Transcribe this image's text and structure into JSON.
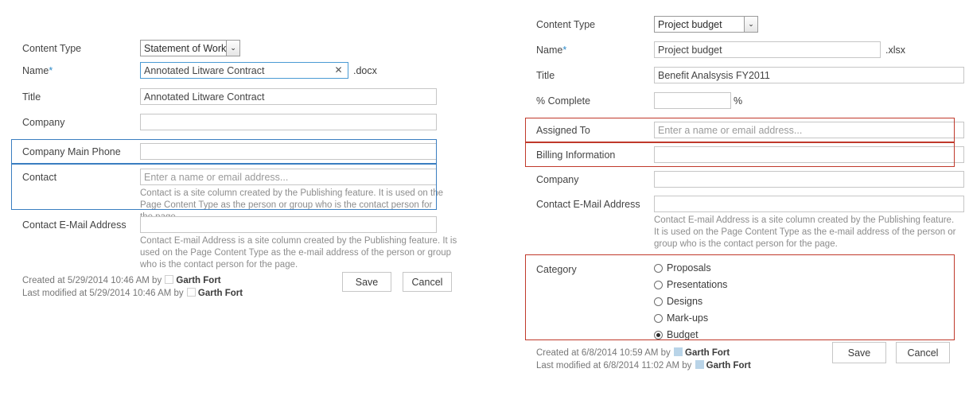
{
  "left_form": {
    "content_type": {
      "label": "Content Type",
      "value": "Statement of Work",
      "arrow": "⌄"
    },
    "name": {
      "label": "Name",
      "required_mark": "*",
      "value": "Annotated Litware Contract",
      "extension": ".docx",
      "clear_glyph": "✕"
    },
    "title": {
      "label": "Title",
      "value": "Annotated Litware Contract"
    },
    "company": {
      "label": "Company",
      "value": ""
    },
    "company_main_phone": {
      "label": "Company Main Phone",
      "value": ""
    },
    "contact": {
      "label": "Contact",
      "placeholder": "Enter a name or email address...",
      "hint": "Contact is a site column created by the Publishing feature. It is used on the Page Content Type as the person or group who is the contact person for the page."
    },
    "contact_email": {
      "label": "Contact E-Mail Address",
      "value": "",
      "hint": "Contact E-mail Address is a site column created by the Publishing feature. It is used on the Page Content Type as the e-mail address of the person or group who is the contact person for the page."
    },
    "footer": {
      "created": "Created at 5/29/2014 10:46 AM",
      "created_by_prefix": "by",
      "created_by": "Garth Fort",
      "modified": "Last modified at 5/29/2014 10:46 AM",
      "modified_by_prefix": "by",
      "modified_by": "Garth Fort",
      "save_label": "Save",
      "cancel_label": "Cancel"
    },
    "highlight_color": "#3a7ec1"
  },
  "right_form": {
    "content_type": {
      "label": "Content Type",
      "value": "Project budget",
      "arrow": "⌄"
    },
    "name": {
      "label": "Name",
      "required_mark": "*",
      "value": "Project budget",
      "extension": ".xlsx"
    },
    "title": {
      "label": "Title",
      "value": "Benefit Analsysis FY2011"
    },
    "percent_complete": {
      "label": "% Complete",
      "value": "",
      "suffix": "%"
    },
    "assigned_to": {
      "label": "Assigned To",
      "placeholder": "Enter a name or email address..."
    },
    "billing_information": {
      "label": "Billing Information",
      "value": ""
    },
    "company": {
      "label": "Company",
      "value": ""
    },
    "contact_email": {
      "label": "Contact E-Mail Address",
      "value": "",
      "hint": "Contact E-mail Address is a site column created by the Publishing feature. It is used on the Page Content Type as the e-mail address of the person or group who is the contact person for the page."
    },
    "category": {
      "label": "Category",
      "options": [
        {
          "label": "Proposals",
          "checked": false
        },
        {
          "label": "Presentations",
          "checked": false
        },
        {
          "label": "Designs",
          "checked": false
        },
        {
          "label": "Mark-ups",
          "checked": false
        },
        {
          "label": "Budget",
          "checked": true
        }
      ]
    },
    "footer": {
      "created": "Created at 6/8/2014 10:59 AM",
      "created_by_prefix": "by",
      "created_by": "Garth Fort",
      "modified": "Last modified at 6/8/2014 11:02 AM",
      "modified_by_prefix": "by",
      "modified_by": "Garth Fort",
      "save_label": "Save",
      "cancel_label": "Cancel"
    },
    "highlight_color": "#c0392b"
  }
}
